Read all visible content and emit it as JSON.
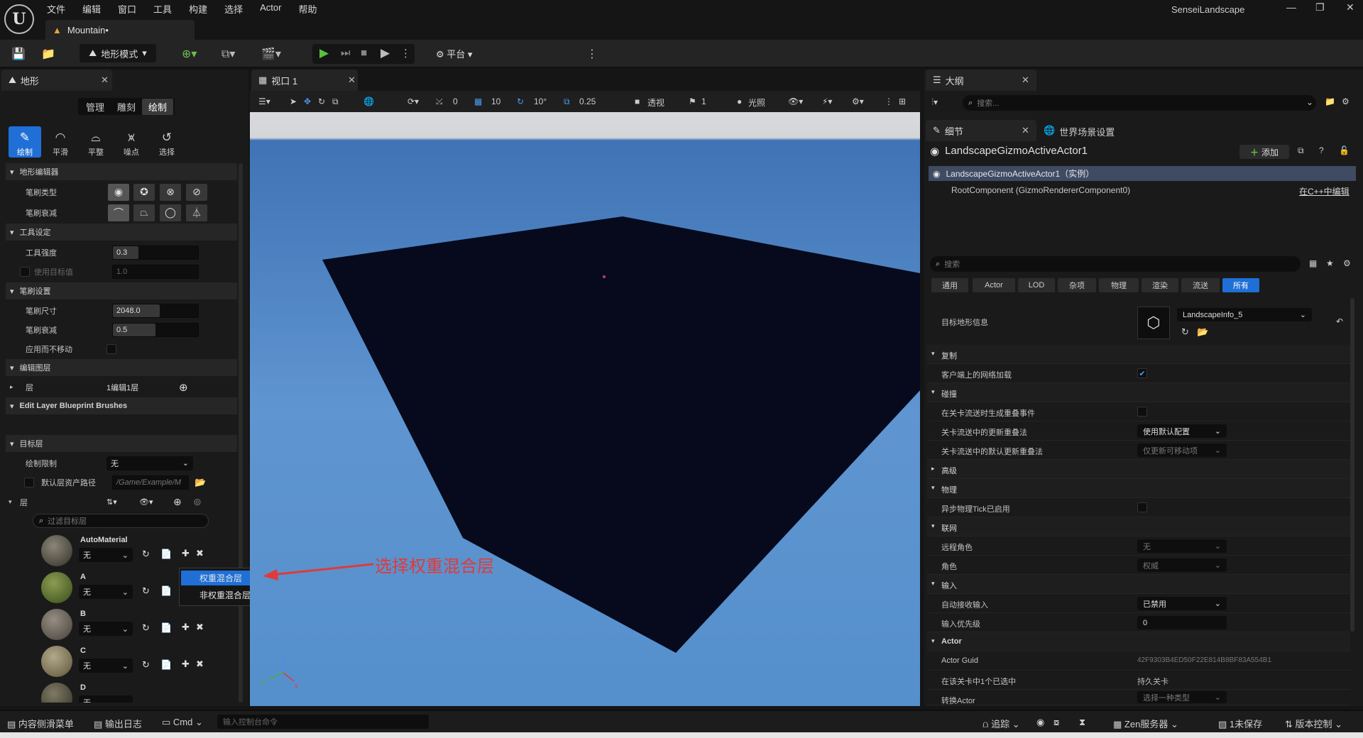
{
  "menu": [
    "文件",
    "编辑",
    "窗口",
    "工具",
    "构建",
    "选择",
    "Actor",
    "帮助"
  ],
  "document_tab": "Mountain•",
  "project_name": "SenseiLandscape",
  "toolbar": {
    "mode": "地形模式",
    "platform": "平台"
  },
  "left_panel": {
    "tab": "地形",
    "subtabs": [
      "管理",
      "雕刻",
      "绘制"
    ],
    "active_subtab": "绘制",
    "tools": [
      "绘制",
      "平滑",
      "平整",
      "噪点",
      "选择"
    ],
    "sections": {
      "landscape_editor": "地形编辑器",
      "tool_settings": "工具设定",
      "brush_settings": "笔刷设置",
      "edit_layers": "编辑图层",
      "blueprint_brushes": "Edit Layer Blueprint Brushes",
      "target_layers": "目标层"
    },
    "brush_type_label": "笔刷类型",
    "brush_falloff_label": "笔刷衰减",
    "tool_strength_label": "工具强度",
    "tool_strength": "0.3",
    "use_target_label": "使用目标值",
    "use_target_value": "1.0",
    "brush_size_label": "笔刷尺寸",
    "brush_size": "2048.0",
    "brush_falloff_value_label": "笔刷衰减",
    "brush_falloff": "0.5",
    "apply_no_move_label": "应用而不移动",
    "layers_label": "层",
    "layers_value": "1编辑1层",
    "paint_limit_label": "绘制限制",
    "paint_limit_value": "无",
    "default_layer_path_label": "默认层资产路径",
    "default_layer_path": "/Game/Example/M",
    "target_layers_label": "层",
    "filter_placeholder": "过滤目标层",
    "layers": [
      {
        "name": "AutoMaterial",
        "value": "无"
      },
      {
        "name": "A",
        "value": "无"
      },
      {
        "name": "B",
        "value": "无"
      },
      {
        "name": "C",
        "value": "无"
      },
      {
        "name": "D",
        "value": "无"
      }
    ]
  },
  "context_menu": [
    "权重混合层",
    "非权重混合层"
  ],
  "annotation": "选择权重混合层",
  "viewport": {
    "tab": "视口 1",
    "perspective": "透视",
    "lighting": "光照",
    "snap_translate": "10",
    "snap_rotate": "10°",
    "snap_scale": "0.25",
    "speed": "1",
    "zero": "0"
  },
  "outliner": {
    "tab": "大纲",
    "search_placeholder": "搜索..."
  },
  "details": {
    "tab": "细节",
    "world_tab": "世界场景设置",
    "actor_name": "LandscapeGizmoActiveActor1",
    "add_label": "添加",
    "instance_row": "LandscapeGizmoActiveActor1（实例）",
    "root_component": "RootComponent (GizmoRendererComponent0)",
    "edit_cpp": "在C++中编辑",
    "search_placeholder": "搜索",
    "filters": [
      "通用",
      "Actor",
      "LOD",
      "杂项",
      "物理",
      "渲染",
      "流送",
      "所有"
    ],
    "active_filter": "所有",
    "target_landscape_label": "目标地形信息",
    "target_landscape_value": "LandscapeInfo_5",
    "rows": {
      "replication": "复制",
      "net_load_on_client": "客户端上的网络加载",
      "collision": "碰撞",
      "gen_overlap": "在关卡流送时生成重叠事件",
      "update_overlap": "关卡流送中的更新重叠法",
      "update_overlap_value": "使用默认配置",
      "default_update_overlap": "关卡流送中的默认更新重叠法",
      "default_update_overlap_value": "仅更新可移动项",
      "advanced": "高级",
      "physics": "物理",
      "async_tick": "异步物理Tick已启用",
      "networking": "联网",
      "remote_role": "远程角色",
      "remote_role_value": "无",
      "role": "角色",
      "role_value": "权威",
      "input": "输入",
      "auto_receive": "自动接收输入",
      "auto_receive_value": "已禁用",
      "input_priority": "输入优先级",
      "input_priority_value": "0",
      "actor": "Actor",
      "actor_guid": "Actor Guid",
      "actor_guid_value": "42F9303B4ED50F22E814B8BF83A554B1",
      "selected_in_level": "在该关卡中1个已选中",
      "selected_in_level_value": "持久关卡",
      "convert_actor": "转换Actor",
      "convert_actor_value": "选择一种类型"
    }
  },
  "statusbar": {
    "content_drawer": "内容侧滑菜单",
    "output_log": "输出日志",
    "cmd": "Cmd",
    "console_placeholder": "输入控制台命令",
    "trace": "追踪",
    "zen": "Zen服务器",
    "unsaved": "1未保存",
    "source_control": "版本控制"
  },
  "colors": {
    "accent": "#1f6fd6",
    "annotation": "#e03a3a",
    "sky": "#5a93cf",
    "landscape": "#060a1c"
  }
}
